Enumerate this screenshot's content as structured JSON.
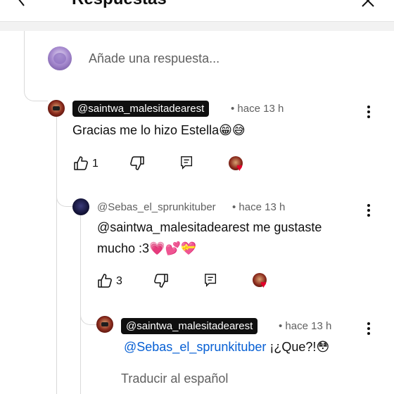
{
  "header": {
    "title": "Respuestas",
    "back_icon": "back-arrow-icon",
    "close_icon": "close-icon"
  },
  "compose": {
    "placeholder": "Añade una respuesta..."
  },
  "replies": [
    {
      "handle": "@saintwa_malesitadearest",
      "time": "• hace 13 h",
      "text": "Gracias me lo hizo Estella",
      "emoji": "😁😅",
      "likes": "1",
      "creator_heart": true
    },
    {
      "handle": "@Sebas_el_sprunkituber",
      "time": "• hace 13 h",
      "text_line1": "@saintwa_malesitadearest me gustaste",
      "text_line2": "mucho :3",
      "emoji": "💗💕💝",
      "likes": "3",
      "creator_heart": true
    },
    {
      "handle": "@saintwa_malesitadearest",
      "time": "• hace 13 h",
      "mention": "@Sebas_el_sprunkituber",
      "text": " ¡¿Que?!",
      "emoji": "😳",
      "translate": "Traducir al español"
    }
  ],
  "colors": {
    "mention": "#065fd4",
    "heart": "#e4002b",
    "secondary_text": "#606060"
  }
}
